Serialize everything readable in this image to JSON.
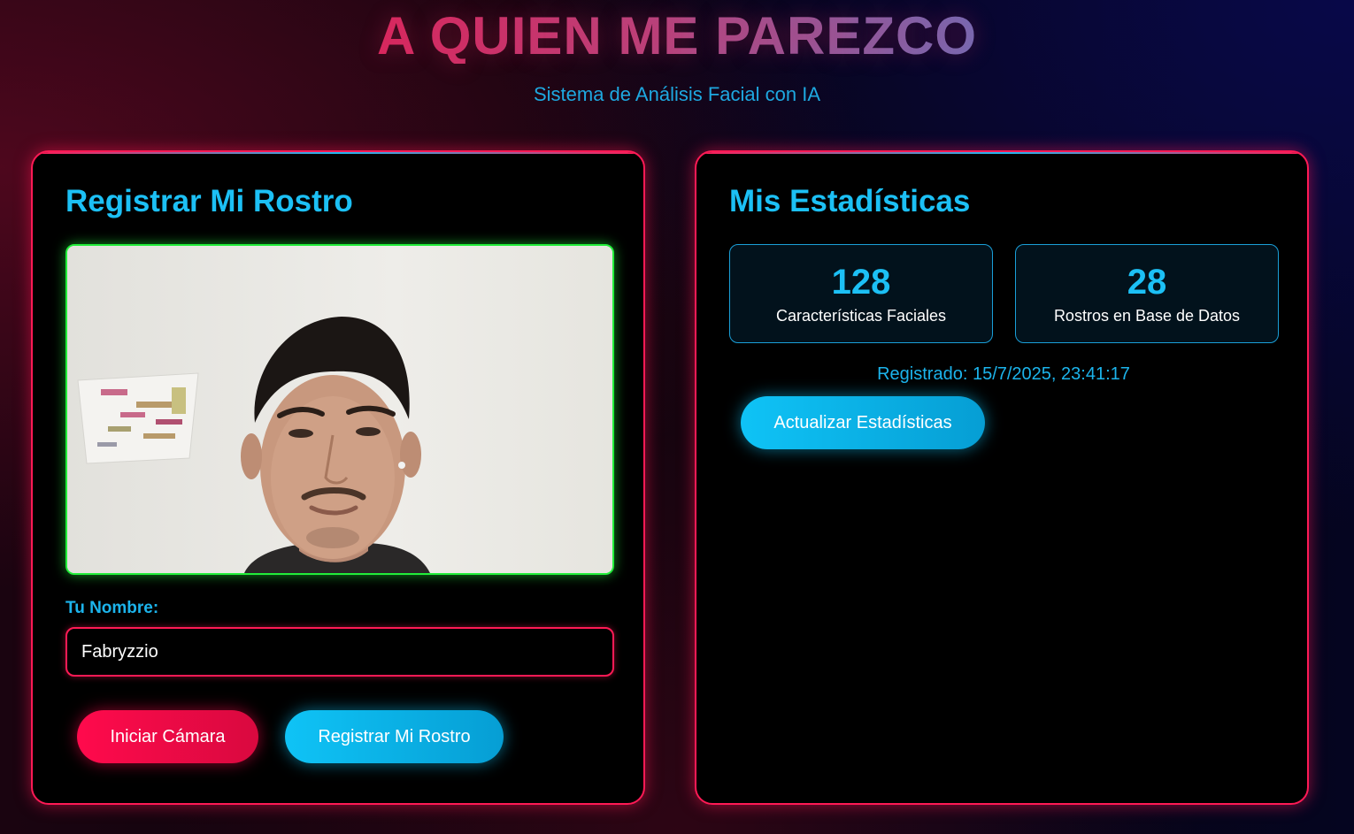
{
  "header": {
    "title": "A QUIEN ME PAREZCO",
    "subtitle": "Sistema de Análisis Facial con IA"
  },
  "register_panel": {
    "title": "Registrar Mi Rostro",
    "name_label": "Tu Nombre:",
    "name_value": "Fabryzzio",
    "start_camera_label": "Iniciar Cámara",
    "register_label": "Registrar Mi Rostro"
  },
  "stats_panel": {
    "title": "Mis Estadísticas",
    "cards": [
      {
        "value": "128",
        "label": "Características Faciales"
      },
      {
        "value": "28",
        "label": "Rostros en Base de Datos"
      }
    ],
    "registered_text": "Registrado: 15/7/2025, 23:41:17",
    "refresh_label": "Actualizar Estadísticas"
  },
  "colors": {
    "accent_red": "#ff1a55",
    "accent_blue": "#1cc0f5",
    "video_border": "#22ee3a"
  }
}
